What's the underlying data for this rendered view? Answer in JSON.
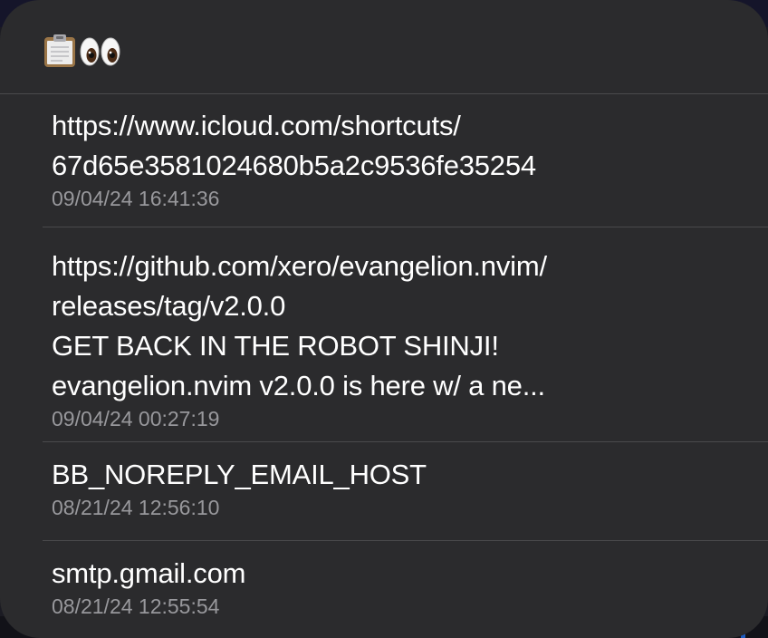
{
  "header": {
    "icons": [
      "clipboard-icon",
      "eyes-icon"
    ]
  },
  "items": [
    {
      "text": "https://www.icloud.com/shortcuts/\n67d65e3581024680b5a2c9536fe35254",
      "time": "09/04/24 16:41:36"
    },
    {
      "text": "https://github.com/xero/evangelion.nvim/\nreleases/tag/v2.0.0\nGET BACK IN THE ROBOT SHINJI!\nevangelion.nvim v2.0.0 is here w/ a ne...",
      "time": "09/04/24 00:27:19"
    },
    {
      "text": "BB_NOREPLY_EMAIL_HOST",
      "time": "08/21/24 12:56:10"
    },
    {
      "text": "smtp.gmail.com",
      "time": "08/21/24 12:55:54"
    }
  ],
  "colors": {
    "panel": "#2b2b2d",
    "text": "#ffffff",
    "secondary": "#98989c",
    "divider": "#4a4a4c"
  }
}
